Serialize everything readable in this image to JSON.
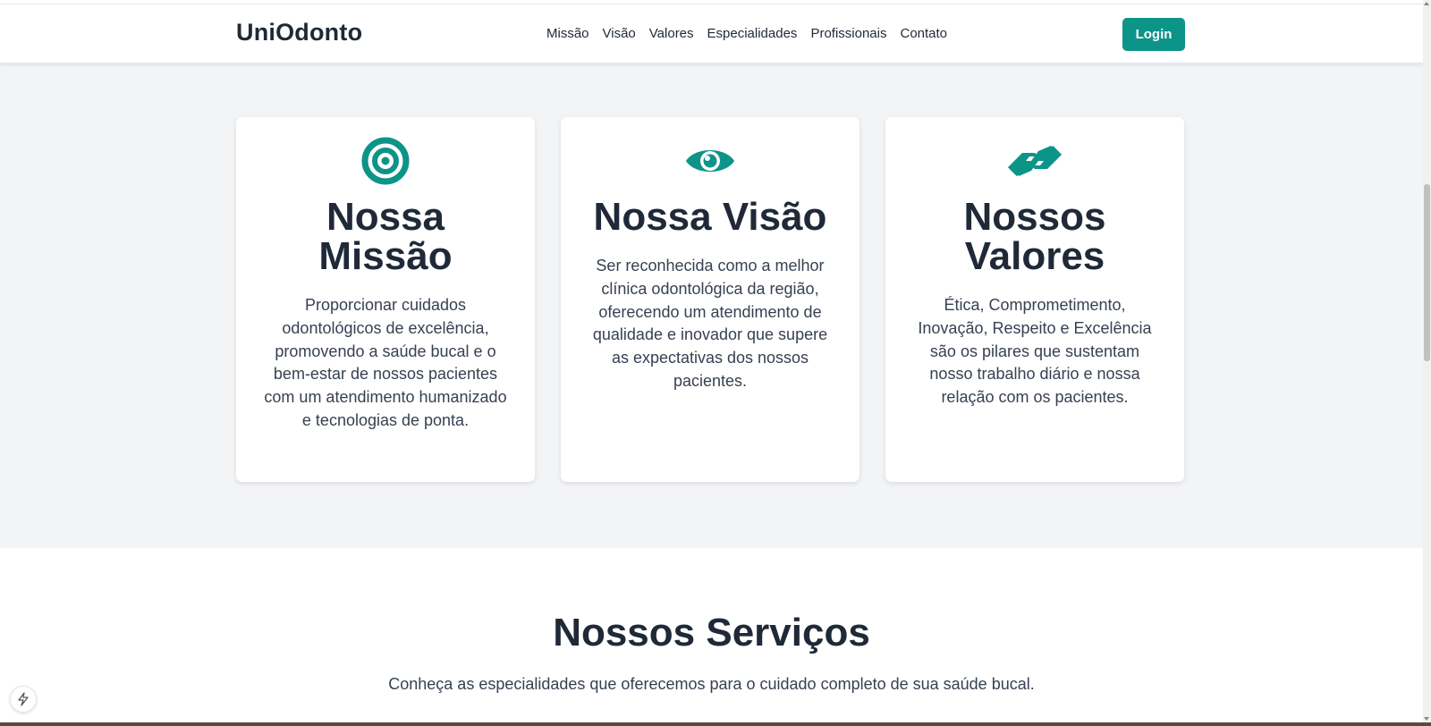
{
  "header": {
    "brand": "UniOdonto",
    "nav": [
      "Missão",
      "Visão",
      "Valores",
      "Especialidades",
      "Profissionais",
      "Contato"
    ],
    "login_label": "Login"
  },
  "cards": [
    {
      "icon": "target-icon",
      "title": "Nossa Missão",
      "text": "Proporcionar cuidados odontológicos de excelência, promovendo a saúde bucal e o bem-estar de nossos pacientes com um atendimento humanizado e tecnologias de ponta."
    },
    {
      "icon": "eye-icon",
      "title": "Nossa Visão",
      "text": "Ser reconhecida como a melhor clínica odontológica da região, oferecendo um atendimento de qualidade e inovador que supere as expectativas dos nossos pacientes."
    },
    {
      "icon": "handshake-icon",
      "title": "Nossos Valores",
      "text": "Ética, Comprometimento, Inovação, Respeito e Excelência são os pilares que sustentam nosso trabalho diário e nossa relação com os pacientes."
    }
  ],
  "services": {
    "title": "Nossos Serviços",
    "subtitle": "Conheça as especialidades que oferecemos para o cuidado completo de sua saúde bucal."
  },
  "colors": {
    "accent": "#0d9488",
    "text": "#1f2937",
    "background": "#f3f4f6"
  }
}
